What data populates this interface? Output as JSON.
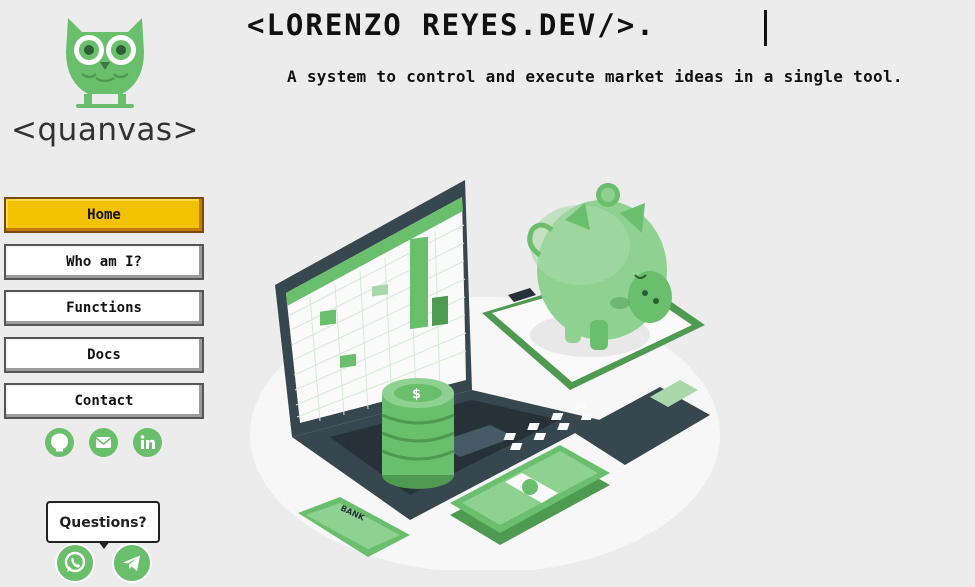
{
  "brand": {
    "logo_text": "<quanvas>"
  },
  "header": {
    "title": "<LORENZO REYES.DEV/>.",
    "subtitle": "A system to control and execute market ideas in a single tool."
  },
  "nav": {
    "items": [
      {
        "label": "Home",
        "active": true
      },
      {
        "label": "Who am I?"
      },
      {
        "label": "Functions"
      },
      {
        "label": "Docs"
      },
      {
        "label": "Contact"
      }
    ]
  },
  "socials": [
    "github-icon",
    "email-icon",
    "linkedin-icon"
  ],
  "contact_widget": {
    "label": "Questions?",
    "channels": [
      "whatsapp-icon",
      "telegram-icon"
    ]
  },
  "illustration": {
    "bank_card_text": "BANK"
  },
  "colors": {
    "accent_green": "#6abf6d",
    "active_nav": "#f2c100",
    "background": "#ececec"
  }
}
